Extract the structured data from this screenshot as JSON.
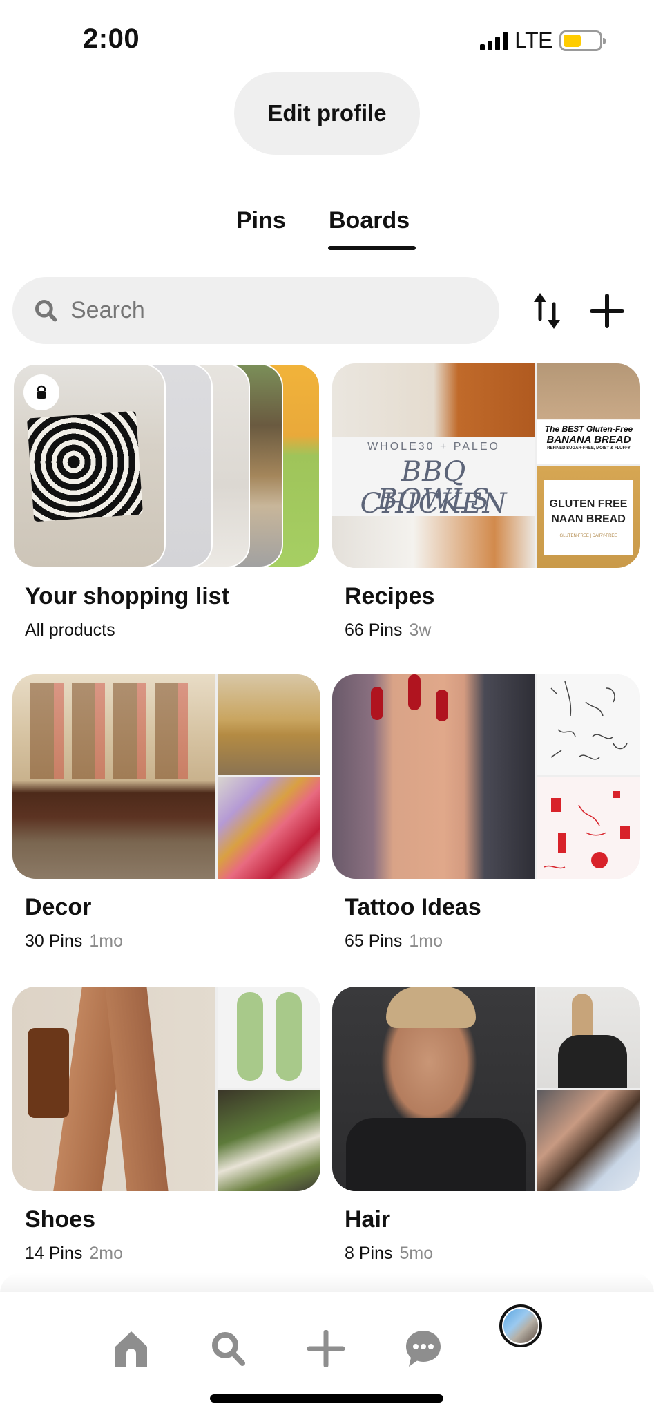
{
  "status_bar": {
    "time": "2:00",
    "network": "LTE",
    "battery_level_percent": 50,
    "battery_color": "#ffcc00"
  },
  "profile": {
    "edit_profile_label": "Edit profile"
  },
  "tabs": [
    {
      "label": "Pins",
      "active": false
    },
    {
      "label": "Boards",
      "active": true
    }
  ],
  "search": {
    "placeholder": "Search",
    "value": ""
  },
  "toolbar": {
    "sort_icon": "sort-arrows-icon",
    "add_icon": "plus-icon"
  },
  "boards": [
    {
      "title": "Your shopping list",
      "subtitle": "All products",
      "age": "",
      "private": true,
      "cover_type": "stacked"
    },
    {
      "title": "Recipes",
      "subtitle": "66 Pins",
      "age": "3w",
      "cover_text": {
        "main_kicker": "WHOLE30 + PALEO",
        "main_title_line1": "BBQ CHICKEN",
        "main_title_line2": "BOWLS",
        "top_line1": "The BEST Gluten-Free",
        "top_line2": "BANANA BREAD",
        "top_line3": "REFINED SUGAR-FREE, MOIST & FLUFFY",
        "bottom_line1": "GLUTEN FREE",
        "bottom_line2": "NAAN BREAD",
        "bottom_line3": "GLUTEN-FREE | DAIRY-FREE"
      }
    },
    {
      "title": "Decor",
      "subtitle": "30 Pins",
      "age": "1mo"
    },
    {
      "title": "Tattoo Ideas",
      "subtitle": "65 Pins",
      "age": "1mo"
    },
    {
      "title": "Shoes",
      "subtitle": "14 Pins",
      "age": "2mo"
    },
    {
      "title": "Hair",
      "subtitle": "8 Pins",
      "age": "5mo"
    }
  ],
  "bottom_nav": [
    {
      "name": "home",
      "icon": "home-icon"
    },
    {
      "name": "search",
      "icon": "search-icon"
    },
    {
      "name": "create",
      "icon": "plus-icon"
    },
    {
      "name": "messages",
      "icon": "chat-bubble-icon"
    },
    {
      "name": "profile",
      "icon": "avatar",
      "active": true
    }
  ],
  "colors": {
    "text_primary": "#111111",
    "text_secondary": "#8a8a8a",
    "pill_bg": "#efefef",
    "nav_icon": "#8e8e8e"
  }
}
